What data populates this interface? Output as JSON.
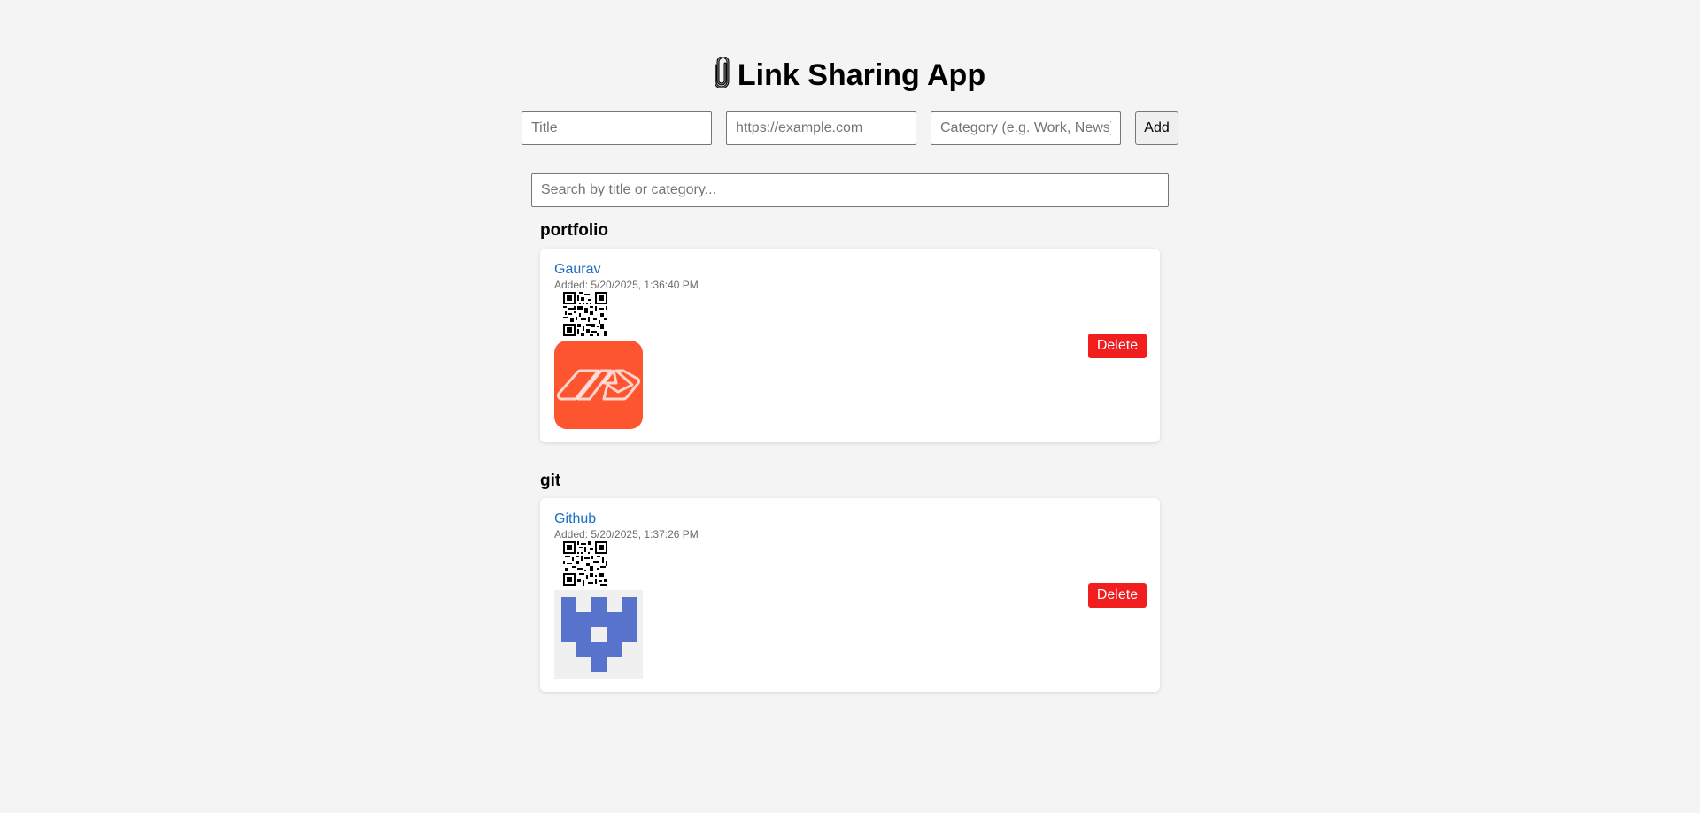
{
  "app": {
    "title": "Link Sharing App",
    "title_icon": "paperclip-icon"
  },
  "form": {
    "title_placeholder": "Title",
    "url_placeholder": "https://example.com",
    "category_placeholder": "Category (e.g. Work, News)",
    "add_label": "Add"
  },
  "search": {
    "placeholder": "Search by title or category..."
  },
  "groups": [
    {
      "category": "portfolio",
      "links": [
        {
          "title": "Gaurav",
          "added": "Added: 5/20/2025, 1:36:40 PM",
          "qr_icon": "qr-code-icon",
          "thumbnail_icon": "orange-logo-icon",
          "thumbnail_color": "#fd5530",
          "delete_label": "Delete"
        }
      ]
    },
    {
      "category": "git",
      "links": [
        {
          "title": "Github",
          "added": "Added: 5/20/2025, 1:37:26 PM",
          "qr_icon": "qr-code-icon",
          "thumbnail_icon": "github-identicon-icon",
          "thumbnail_color": "#5873cc",
          "delete_label": "Delete"
        }
      ]
    }
  ],
  "colors": {
    "background": "#f4f4f4",
    "link": "#1a6fc4",
    "delete_button": "#f01e1e"
  }
}
